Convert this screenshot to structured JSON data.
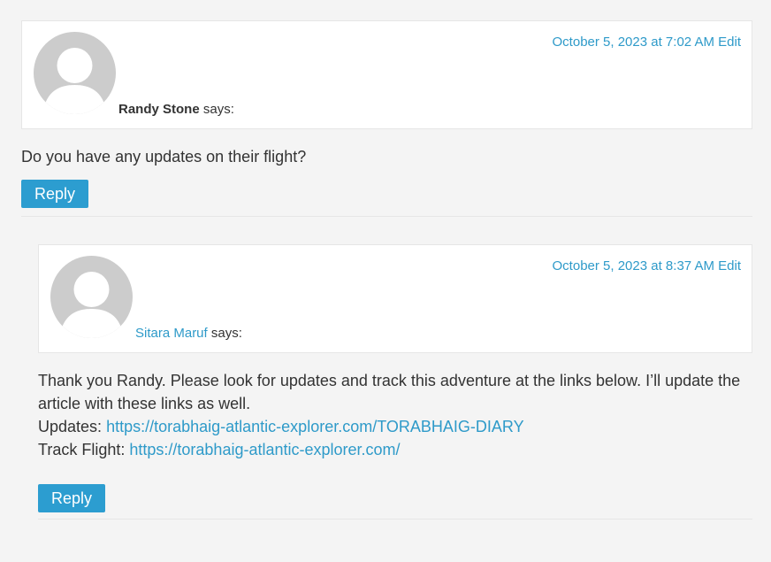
{
  "comments": [
    {
      "author": "Randy Stone",
      "says": "says:",
      "date": "October 5, 2023 at 7:02 AM",
      "edit": "Edit",
      "body": "Do you have any updates on their flight?",
      "reply": "Reply"
    },
    {
      "author": "Sitara Maruf",
      "says": "says:",
      "date": "October 5, 2023 at 8:37 AM",
      "edit": "Edit",
      "body_line1": "Thank you Randy. Please look for updates and track this adventure at the links below. I’ll update the article with these links as well.",
      "updates_label": "Updates:",
      "updates_link": "https://torabhaig-atlantic-explorer.com/TORABHAIG-DIARY",
      "track_label": "Track Flight:",
      "track_link": "https://torabhaig-atlantic-explorer.com/",
      "reply": "Reply"
    }
  ],
  "colors": {
    "accent": "#2c9dd0",
    "link": "#2e9ac9",
    "background": "#f4f4f4"
  }
}
